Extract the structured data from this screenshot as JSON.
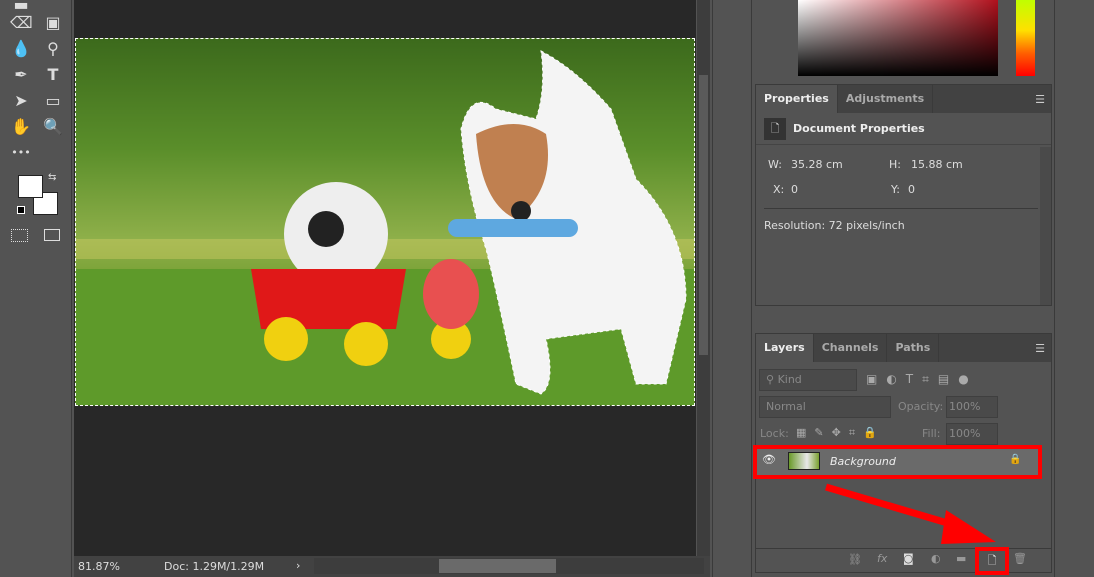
{
  "toolbar": {
    "tools": [
      "eraser-icon",
      "gradient-icon",
      "blur-icon",
      "dodge-icon",
      "pen-icon",
      "type-icon",
      "path-select-icon",
      "rectangle-icon",
      "hand-icon",
      "zoom-icon",
      "more-icon"
    ],
    "more_label": "•••"
  },
  "status": {
    "zoom": "81.87%",
    "doc": "Doc: 1.29M/1.29M"
  },
  "properties": {
    "tabs": [
      "Properties",
      "Adjustments"
    ],
    "title": "Document Properties",
    "w_label": "W:",
    "w_value": "35.28 cm",
    "h_label": "H:",
    "h_value": "15.88 cm",
    "x_label": "X:",
    "x_value": "0",
    "y_label": "Y:",
    "y_value": "0",
    "resolution": "Resolution: 72 pixels/inch"
  },
  "layers": {
    "tabs": [
      "Layers",
      "Channels",
      "Paths"
    ],
    "filter_kind": "Kind",
    "blend_mode": "Normal",
    "opacity_label": "Opacity:",
    "opacity_value": "100%",
    "lock_label": "Lock:",
    "fill_label": "Fill:",
    "fill_value": "100%",
    "layer_name": "Background"
  },
  "colors": {
    "highlight": "#ff0000",
    "panel": "#535353",
    "canvas": "#282828"
  }
}
